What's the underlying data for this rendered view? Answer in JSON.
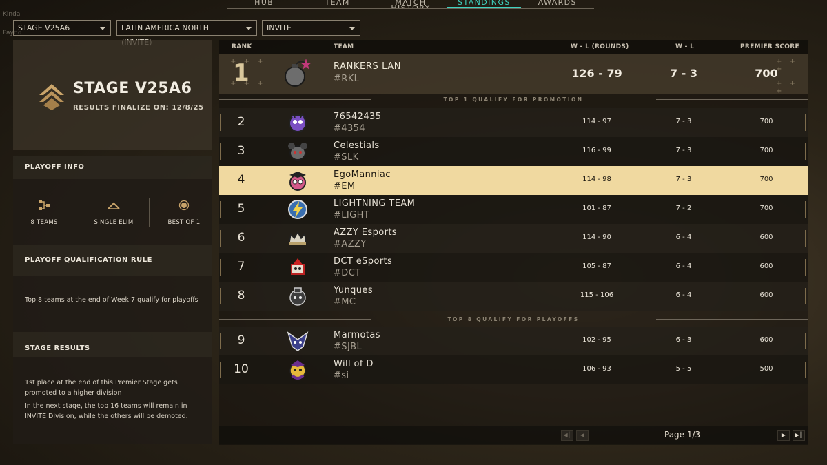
{
  "corner": {
    "line1": "Kinda",
    "line2": "Payno"
  },
  "nav": {
    "tabs": [
      "HUB",
      "TEAM",
      "MATCH HISTORY",
      "STANDINGS",
      "AWARDS"
    ],
    "active": "STANDINGS"
  },
  "filters": {
    "stage": "STAGE V25A6",
    "region": "LATIN AMERICA NORTH (INVITE)",
    "division": "INVITE"
  },
  "stage_card": {
    "title": "STAGE V25A6",
    "finalize": "RESULTS FINALIZE ON: 12/8/25"
  },
  "playoff": {
    "heading": "PLAYOFF INFO",
    "teams": "8 TEAMS",
    "format": "SINGLE ELIM",
    "bestof": "BEST OF 1",
    "rule_heading": "PLAYOFF QUALIFICATION RULE",
    "rule_text": "Top 8 teams at the end of Week 7 qualify for playoffs"
  },
  "results": {
    "heading": "STAGE RESULTS",
    "text1": "1st place at the end of this Premier Stage gets promoted to a higher division",
    "text2": "In the next stage, the top 16 teams will remain in INVITE Division, while the others will be demoted."
  },
  "table": {
    "headers": {
      "rank": "RANK",
      "team": "TEAM",
      "rounds": "W - L (ROUNDS)",
      "wl": "W - L",
      "score": "PREMIER SCORE"
    },
    "leader": {
      "rank": "1",
      "name": "RANKERS LAN",
      "tag": "#RKL",
      "rounds": "126 - 79",
      "wl": "7 - 3",
      "score": "700"
    },
    "sep1": "TOP 1 QUALIFY FOR PROMOTION",
    "sep2": "TOP 8 QUALIFY FOR PLAYOFFS",
    "rows": [
      {
        "rank": "2",
        "name": "76542435",
        "tag": "#4354",
        "rounds": "114 - 97",
        "wl": "7 - 3",
        "score": "700"
      },
      {
        "rank": "3",
        "name": "Celestials",
        "tag": "#SLK",
        "rounds": "116 - 99",
        "wl": "7 - 3",
        "score": "700"
      },
      {
        "rank": "4",
        "name": "EgoManniac",
        "tag": "#EM",
        "rounds": "114 - 98",
        "wl": "7 - 3",
        "score": "700"
      },
      {
        "rank": "5",
        "name": "LIGHTNING TEAM",
        "tag": "#LIGHT",
        "rounds": "101 - 87",
        "wl": "7 - 2",
        "score": "700"
      },
      {
        "rank": "6",
        "name": "AZZY Esports",
        "tag": "#AZZY",
        "rounds": "114 - 90",
        "wl": "6 - 4",
        "score": "600"
      },
      {
        "rank": "7",
        "name": "DCT eSports",
        "tag": "#DCT",
        "rounds": "105 - 87",
        "wl": "6 - 4",
        "score": "600"
      },
      {
        "rank": "8",
        "name": "Yunques",
        "tag": "#MC",
        "rounds": "115 - 106",
        "wl": "6 - 4",
        "score": "600"
      },
      {
        "rank": "9",
        "name": "Marmotas",
        "tag": "#SJBL",
        "rounds": "102 - 95",
        "wl": "6 - 3",
        "score": "600"
      },
      {
        "rank": "10",
        "name": "Will of D",
        "tag": "#si",
        "rounds": "106 - 93",
        "wl": "5 - 5",
        "score": "500"
      }
    ]
  },
  "pager": {
    "text": "Page 1/3"
  }
}
